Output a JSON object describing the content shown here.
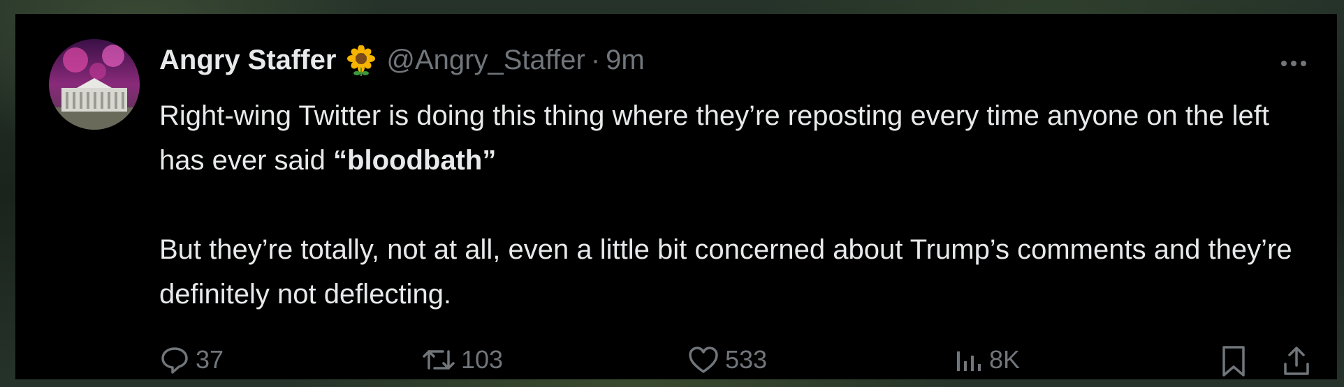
{
  "tweet": {
    "author_name": "Angry Staffer",
    "badge_emoji": "sunflower",
    "handle": "@Angry_Staffer",
    "separator": "·",
    "time": "9m",
    "text_line1_part1": "Right-wing Twitter is doing this thing where they’re reposting every time anyone on the left has ever said ",
    "text_line1_bold": "“bloodbath”",
    "text_para2": "But they’re totally, not at all, even a little bit concerned about Trump’s comments and they’re definitely not deflecting."
  },
  "actions": {
    "replies": "37",
    "reposts": "103",
    "likes": "533",
    "views": "8K"
  },
  "icons": {
    "reply": "speech-bubble-icon",
    "repost": "repost-arrows-icon",
    "like": "heart-icon",
    "views": "bar-chart-icon",
    "bookmark": "bookmark-icon",
    "share": "share-upload-icon",
    "more": "ellipsis-icon"
  },
  "colors": {
    "background": "#000000",
    "text_primary": "#e7e9ea",
    "text_secondary": "#71767b"
  }
}
